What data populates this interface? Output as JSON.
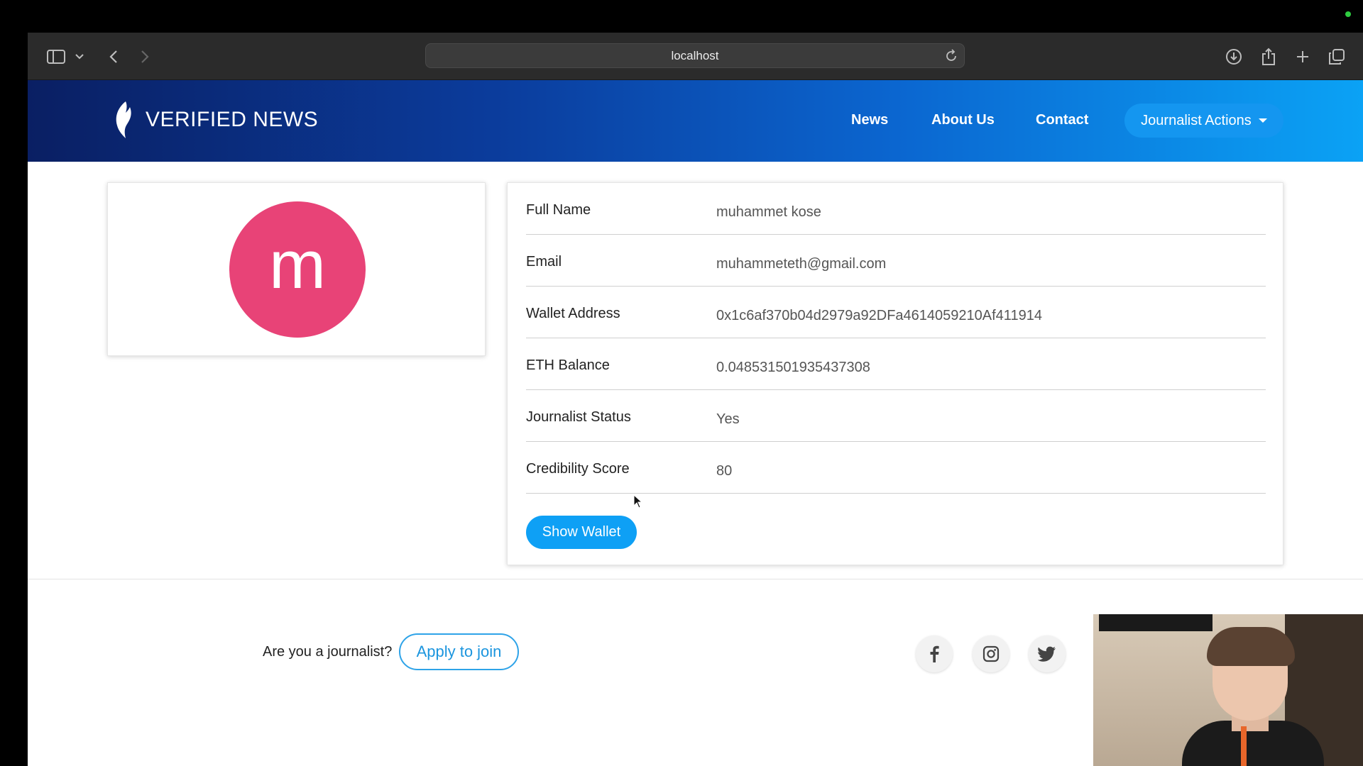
{
  "browser": {
    "url": "localhost"
  },
  "site": {
    "brand": "VERIFIED NEWS",
    "nav": {
      "news": "News",
      "about": "About Us",
      "contact": "Contact",
      "journalist_actions": "Journalist Actions"
    }
  },
  "profile": {
    "avatar_letter": "m",
    "avatar_color": "#e84377",
    "fields": [
      {
        "label": "Full Name",
        "value": "muhammet kose"
      },
      {
        "label": "Email",
        "value": "muhammeteth@gmail.com"
      },
      {
        "label": "Wallet Address",
        "value": "0x1c6af370b04d2979a92DFa4614059210Af411914"
      },
      {
        "label": "ETH Balance",
        "value": "0.048531501935437308"
      },
      {
        "label": "Journalist Status",
        "value": "Yes"
      },
      {
        "label": "Credibility Score",
        "value": "80"
      }
    ],
    "show_wallet_label": "Show Wallet"
  },
  "footer": {
    "question": "Are you a journalist?",
    "apply_label": "Apply to join",
    "social": [
      "facebook-icon",
      "instagram-icon",
      "twitter-icon"
    ]
  },
  "colors": {
    "accent": "#0ea0f5",
    "header_start": "#0a1f63",
    "header_end": "#0ba2f5"
  }
}
